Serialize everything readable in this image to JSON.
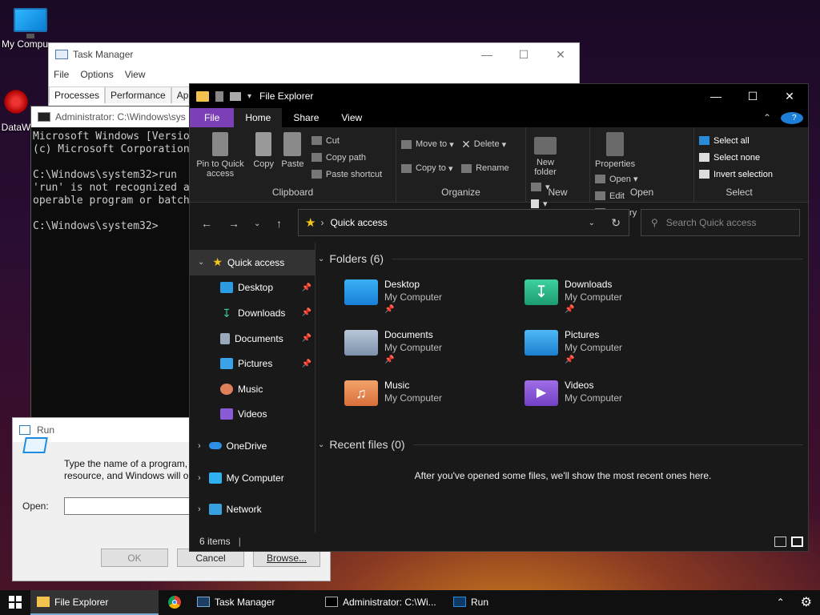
{
  "desktop": {
    "my_computer_label": "My Compu",
    "datawrapper_label": "DataW"
  },
  "task_manager": {
    "title": "Task Manager",
    "menu": [
      "File",
      "Options",
      "View"
    ],
    "tabs": [
      "Processes",
      "Performance",
      "App"
    ]
  },
  "cmd": {
    "title": "Administrator: C:\\Windows\\sys",
    "text": "Microsoft Windows [Versio\n(c) Microsoft Corporation\n\nC:\\Windows\\system32>run\n'run' is not recognized a\noperable program or batch\n\nC:\\Windows\\system32>"
  },
  "run": {
    "title": "Run",
    "description_line1": "Type the name of a program, f",
    "description_line2": "resource, and Windows will op",
    "open_label": "Open:",
    "open_value": "",
    "ok": "OK",
    "cancel": "Cancel",
    "browse": "Browse..."
  },
  "explorer": {
    "title": "File Explorer",
    "tabs": {
      "file": "File",
      "home": "Home",
      "share": "Share",
      "view": "View"
    },
    "ribbon": {
      "clipboard": {
        "label": "Clipboard",
        "pin": "Pin to Quick access",
        "copy": "Copy",
        "paste": "Paste",
        "cut": "Cut",
        "copy_path": "Copy path",
        "paste_shortcut": "Paste shortcut"
      },
      "organize": {
        "label": "Organize",
        "move_to": "Move to",
        "copy_to": "Copy to",
        "delete": "Delete",
        "rename": "Rename"
      },
      "new": {
        "label": "New",
        "new_folder": "New folder"
      },
      "open": {
        "label": "Open",
        "properties": "Properties",
        "open": "Open",
        "edit": "Edit",
        "history": "History"
      },
      "select": {
        "label": "Select",
        "select_all": "Select all",
        "select_none": "Select none",
        "invert": "Invert selection"
      }
    },
    "address": "Quick access",
    "search_placeholder": "Search Quick access",
    "nav": {
      "quick_access": "Quick access",
      "desktop": "Desktop",
      "downloads": "Downloads",
      "documents": "Documents",
      "pictures": "Pictures",
      "music": "Music",
      "videos": "Videos",
      "onedrive": "OneDrive",
      "my_computer": "My Computer",
      "network": "Network"
    },
    "folders_header": "Folders (6)",
    "folders": [
      {
        "name": "Desktop",
        "location": "My Computer",
        "color": "#1f9be8"
      },
      {
        "name": "Downloads",
        "location": "My Computer",
        "color": "#27b58a"
      },
      {
        "name": "Documents",
        "location": "My Computer",
        "color": "#8ea4c0"
      },
      {
        "name": "Pictures",
        "location": "My Computer",
        "color": "#2f9ae0"
      },
      {
        "name": "Music",
        "location": "My Computer",
        "color": "#e58a4a"
      },
      {
        "name": "Videos",
        "location": "My Computer",
        "color": "#8c55d6"
      }
    ],
    "recent_header": "Recent files (0)",
    "recent_empty": "After you've opened some files, we'll show the most recent ones here.",
    "status": "6 items"
  },
  "taskbar": {
    "file_explorer": "File Explorer",
    "task_manager": "Task Manager",
    "cmd": "Administrator: C:\\Wi...",
    "run": "Run"
  }
}
